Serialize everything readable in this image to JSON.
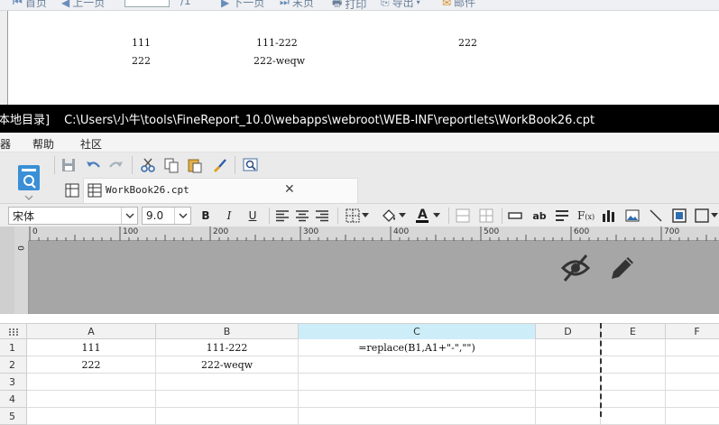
{
  "preview": {
    "toolbar": {
      "first_page": "首页",
      "prev_page": "上一页",
      "page_total": "/1",
      "next_page": "下一页",
      "last_page": "末页",
      "print": "打印",
      "export": "导出",
      "email": "邮件"
    },
    "rows": [
      {
        "a": "111",
        "b": "111-222",
        "c": "222"
      },
      {
        "a": "222",
        "b": "222-weqw",
        "c": ""
      }
    ]
  },
  "titlebar": {
    "prefix": "本地目录]",
    "path": "C:\\Users\\小牛\\tools\\FineReport_10.0\\webapps\\webroot\\WEB-INF\\reportlets\\WorkBook26.cpt"
  },
  "menubar": {
    "items": [
      "器",
      "帮助",
      "社区"
    ]
  },
  "tabs": {
    "active": "WorkBook26.cpt"
  },
  "format": {
    "font_family": "宋体",
    "font_size": "9.0"
  },
  "ruler": {
    "marks": [
      "0",
      "100",
      "200",
      "300",
      "400",
      "500",
      "600",
      "700"
    ],
    "vertical_zero": "0"
  },
  "grid": {
    "columns": [
      "A",
      "B",
      "C",
      "D",
      "E",
      "F"
    ],
    "rows": [
      {
        "num": "1",
        "a": "111",
        "b": "111-222",
        "c": "=replace(B1,A1+\"-\",\"\")"
      },
      {
        "num": "2",
        "a": "222",
        "b": "222-weqw",
        "c": ""
      },
      {
        "num": "3",
        "a": "",
        "b": "",
        "c": ""
      },
      {
        "num": "4",
        "a": "",
        "b": "",
        "c": ""
      },
      {
        "num": "5",
        "a": "",
        "b": "",
        "c": ""
      }
    ]
  },
  "colors": {
    "selected_column": "#cdeef9",
    "titlebar_bg": "#000000",
    "ruler_bg": "#a6a6a6"
  }
}
